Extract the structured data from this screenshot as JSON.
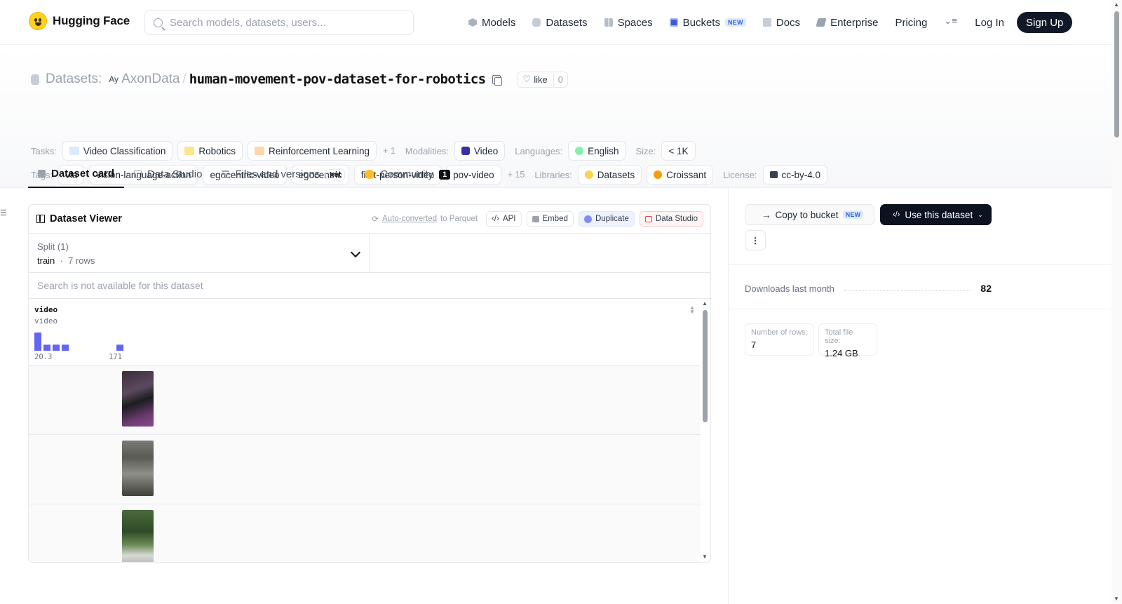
{
  "brand": {
    "name": "Hugging Face"
  },
  "search": {
    "placeholder": "Search models, datasets, users..."
  },
  "nav": {
    "models": "Models",
    "datasets": "Datasets",
    "spaces": "Spaces",
    "buckets": "Buckets",
    "buckets_badge": "NEW",
    "docs": "Docs",
    "enterprise": "Enterprise",
    "pricing": "Pricing",
    "login": "Log In",
    "signup": "Sign Up"
  },
  "repo": {
    "type_label": "Datasets:",
    "org": "AxonData",
    "separator": "/",
    "name": "human-movement-pov-dataset-for-robotics",
    "like_label": "like",
    "like_count": "0"
  },
  "meta": {
    "tasks_label": "Tasks:",
    "tasks": [
      "Video Classification",
      "Robotics",
      "Reinforcement Learning"
    ],
    "tasks_more": "+ 1",
    "modalities_label": "Modalities:",
    "modality": "Video",
    "languages_label": "Languages:",
    "language": "English",
    "size_label": "Size:",
    "size": "< 1K",
    "tags_label": "Tags:",
    "tags": [
      "vla",
      "vision-language-action",
      "egocentric-video",
      "egocentric",
      "first-person-video",
      "pov-video"
    ],
    "tags_more": "+ 15",
    "libraries_label": "Libraries:",
    "libraries": [
      "Datasets",
      "Croissant"
    ],
    "license_label": "License:",
    "license": "cc-by-4.0"
  },
  "tabs": {
    "card": "Dataset card",
    "studio": "Data Studio",
    "files": "Files and versions",
    "files_badge": "xet",
    "community": "Community",
    "community_count": "1"
  },
  "viewer": {
    "title": "Dataset Viewer",
    "auto_converted": "Auto-converted",
    "to_parquet": "to Parquet",
    "api": "API",
    "embed": "Embed",
    "duplicate": "Duplicate",
    "data_studio": "Data Studio",
    "split_label": "Split (1)",
    "split_name": "train",
    "split_rows": "7 rows",
    "search_disabled": "Search is not available for this dataset",
    "column_name": "video",
    "column_type": "video",
    "hist_min": "20.3",
    "hist_max": "171",
    "histogram": [
      3,
      1,
      1,
      1,
      0,
      0,
      0,
      0,
      0,
      1
    ]
  },
  "sidebar": {
    "copy_bucket": "Copy to bucket",
    "copy_badge": "NEW",
    "use_dataset": "Use this dataset",
    "downloads_label": "Downloads last month",
    "downloads": "82",
    "rows_label": "Number of rows:",
    "rows": "7",
    "filesize_label": "Total file size:",
    "filesize": "1.24 GB"
  },
  "colors": {
    "accent": "#6366f1",
    "dark": "#111827"
  }
}
